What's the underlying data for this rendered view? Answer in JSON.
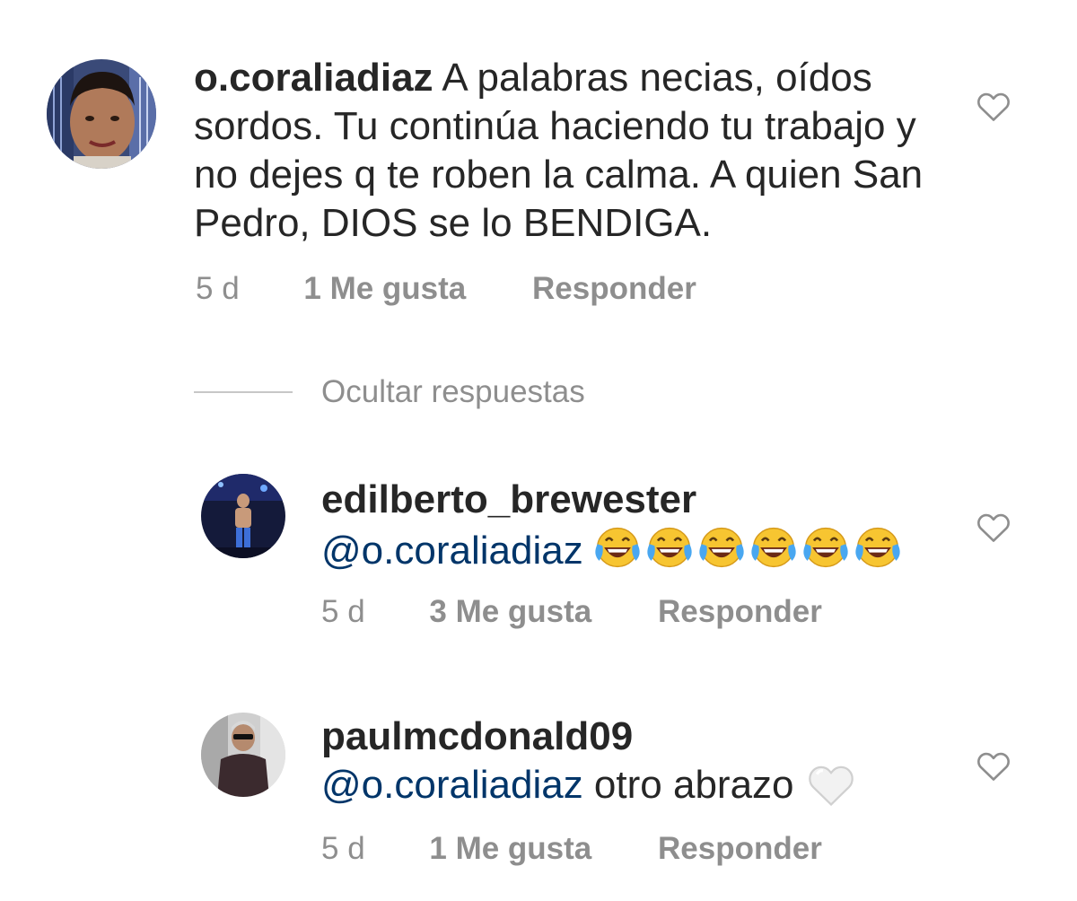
{
  "comments": [
    {
      "username": "o.coraliadiaz",
      "text": " A palabras necias, oídos sordos. Tu continúa haciendo tu trabajo y no dejes q te roben la calma. A quien San Pedro, DIOS se lo BENDIGA.",
      "time": "5 d",
      "likes": "1 Me gusta",
      "reply": "Responder"
    }
  ],
  "hide_replies_label": "Ocultar respuestas",
  "replies": [
    {
      "username": "edilberto_brewester",
      "mention": "@o.coraliadiaz",
      "text": "",
      "emoji_name": "face-with-tears-of-joy",
      "emoji_count": 6,
      "time": "5 d",
      "likes": "3 Me gusta",
      "reply": "Responder"
    },
    {
      "username": "paulmcdonald09",
      "mention": "@o.coraliadiaz",
      "text": " otro abrazo",
      "emoji_name": "white-heart",
      "time": "5 d",
      "likes": "1 Me gusta",
      "reply": "Responder"
    }
  ],
  "colors": {
    "text": "#262626",
    "secondary": "#8e8e8e",
    "mention": "#003569",
    "divider": "#c7c7c7"
  }
}
